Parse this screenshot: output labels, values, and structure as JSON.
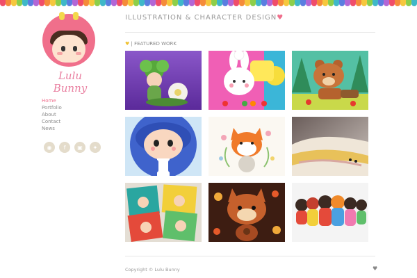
{
  "site_title": "ILLUSTRATION & CHARACTER DESIGN",
  "title_heart": "♥",
  "brand_name": "Lulu Bunny",
  "nav": [
    {
      "label": "Home",
      "active": true
    },
    {
      "label": "Portfolio",
      "active": false
    },
    {
      "label": "About",
      "active": false
    },
    {
      "label": "Contact",
      "active": false
    },
    {
      "label": "News",
      "active": false
    }
  ],
  "social_icons": [
    "rss-icon",
    "facebook-icon",
    "instagram-icon",
    "twitter-icon"
  ],
  "section": {
    "heart": "♥",
    "label": "| FEATURED WORK"
  },
  "footer": {
    "copyright": "Copyright © Lulu Bunny",
    "heart": "♥"
  },
  "colors": {
    "accent": "#ef6f8c",
    "border_rainbow": [
      "#f04d6a",
      "#f58b3a",
      "#f6c73d",
      "#8dcf4a",
      "#3fb8c8",
      "#5a7ee0",
      "#b266d6"
    ]
  }
}
